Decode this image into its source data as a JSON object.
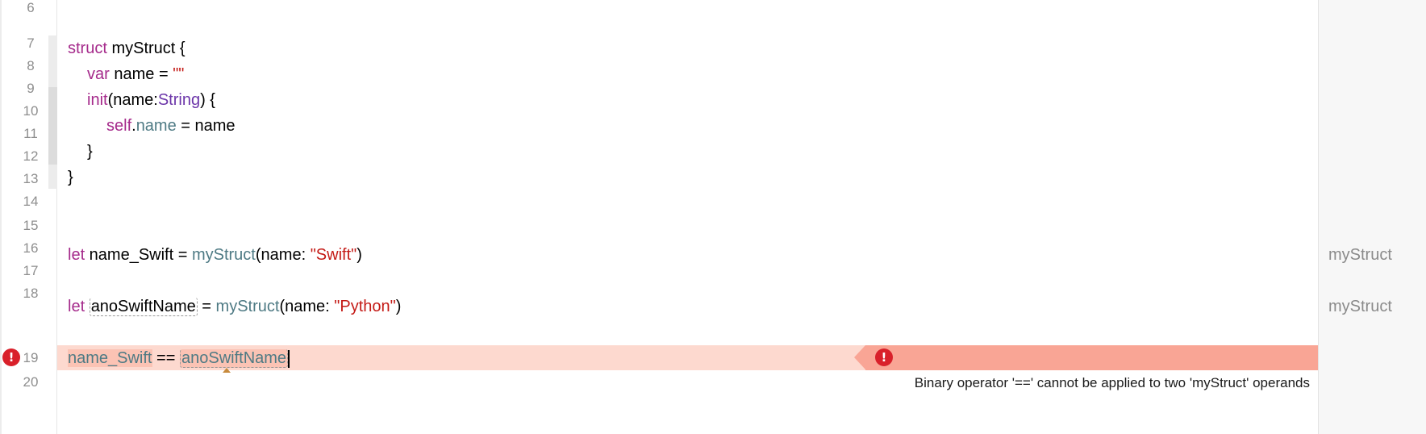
{
  "gutter": {
    "line_numbers": [
      "6",
      "7",
      "8",
      "9",
      "10",
      "11",
      "12",
      "13",
      "14",
      "15",
      "16",
      "17",
      "18",
      "19",
      "20"
    ]
  },
  "code": {
    "line7": {
      "kw": "struct",
      "rest": " myStruct {"
    },
    "line8": {
      "kw": "var",
      "rest": " name = ",
      "str": "\"\""
    },
    "line9": {
      "kw": "init",
      "open": "(name:",
      "type": "String",
      "close": ") {"
    },
    "line10": {
      "self": "self",
      "dot": ".",
      "member": "name",
      "rest": " = name"
    },
    "line11": {
      "text": "}"
    },
    "line12": {
      "text": "}"
    },
    "line15": {
      "kw": "let",
      "name": " name_Swift = ",
      "type": "myStruct",
      "open": "(name: ",
      "str": "\"Swift\"",
      "close": ")"
    },
    "line17": {
      "kw": "let",
      "name": "anoSwiftName",
      "eq": " = ",
      "type": "myStruct",
      "open": "(name: ",
      "str": "\"Python\"",
      "close": ")"
    },
    "line19": {
      "lhs": "name_Swift",
      "op": " == ",
      "rhs": "anoSwiftName"
    }
  },
  "error": {
    "icon": "error-icon",
    "message": "Binary operator '==' cannot be applied to two 'myStruct' operands",
    "color_band": "#fdd9cf",
    "color_message": "#f9a595",
    "color_icon": "#d9202a"
  },
  "results": {
    "line15": "myStruct",
    "line17": "myStruct"
  }
}
